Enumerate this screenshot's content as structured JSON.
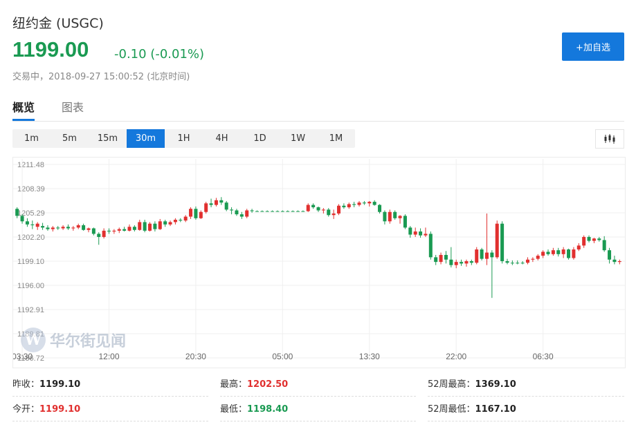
{
  "header": {
    "title": "纽约金 (USGC)",
    "price": "1199.00",
    "change": "-0.10 (-0.01%)",
    "status": "交易中，2018-09-27 15:00:52 (北京时间)",
    "add_watchlist": "+加自选"
  },
  "colors": {
    "up": "#e1302f",
    "down": "#1a9a52",
    "accent": "#1478dc",
    "flat": "#1a9a52"
  },
  "tabs": [
    {
      "label": "概览",
      "active": true
    },
    {
      "label": "图表",
      "active": false
    }
  ],
  "periods": [
    {
      "label": "1m",
      "active": false
    },
    {
      "label": "5m",
      "active": false
    },
    {
      "label": "15m",
      "active": false
    },
    {
      "label": "30m",
      "active": true
    },
    {
      "label": "1H",
      "active": false
    },
    {
      "label": "4H",
      "active": false
    },
    {
      "label": "1D",
      "active": false
    },
    {
      "label": "1W",
      "active": false
    },
    {
      "label": "1M",
      "active": false
    }
  ],
  "chart_type_icon": "candlestick-icon",
  "watermark": {
    "logo": "W",
    "text": "华尔街见闻"
  },
  "chart_data": {
    "type": "candlestick",
    "y_ticks": [
      "1211.48",
      "1208.39",
      "1205.29",
      "1202.20",
      "1199.10",
      "1196.00",
      "1192.91",
      "1189.81",
      "1186.72"
    ],
    "ylim": [
      1186.72,
      1211.48
    ],
    "x_ticks": [
      {
        "label": "03:30",
        "index": 1
      },
      {
        "label": "12:00",
        "index": 18
      },
      {
        "label": "20:30",
        "index": 35
      },
      {
        "label": "05:00",
        "index": 52
      },
      {
        "label": "13:30",
        "index": 69
      },
      {
        "label": "22:00",
        "index": 86
      },
      {
        "label": "06:30",
        "index": 103
      }
    ],
    "candles": [
      [
        1205.8,
        1206.0,
        1204.6,
        1204.9
      ],
      [
        1204.9,
        1205.1,
        1203.9,
        1204.2
      ],
      [
        1204.2,
        1204.6,
        1203.5,
        1203.8
      ],
      [
        1203.8,
        1204.3,
        1203.2,
        1203.7
      ],
      [
        1203.5,
        1204.1,
        1203.1,
        1203.9
      ],
      [
        1203.6,
        1204.0,
        1203.1,
        1203.4
      ],
      [
        1203.4,
        1203.7,
        1203.0,
        1203.2
      ],
      [
        1203.2,
        1203.6,
        1202.9,
        1203.4
      ],
      [
        1203.4,
        1203.6,
        1203.1,
        1203.3
      ],
      [
        1203.3,
        1203.7,
        1203.1,
        1203.5
      ],
      [
        1203.5,
        1203.8,
        1203.1,
        1203.3
      ],
      [
        1203.3,
        1203.6,
        1203.0,
        1203.4
      ],
      [
        1203.4,
        1203.9,
        1203.2,
        1203.7
      ],
      [
        1203.7,
        1203.9,
        1203.0,
        1203.1
      ],
      [
        1203.1,
        1203.4,
        1202.8,
        1203.3
      ],
      [
        1203.3,
        1203.4,
        1202.4,
        1202.6
      ],
      [
        1202.6,
        1202.8,
        1201.2,
        1202.2
      ],
      [
        1202.2,
        1203.3,
        1202.0,
        1203.0
      ],
      [
        1203.0,
        1203.3,
        1202.6,
        1202.9
      ],
      [
        1202.9,
        1203.2,
        1202.6,
        1203.0
      ],
      [
        1203.0,
        1203.4,
        1202.7,
        1203.2
      ],
      [
        1203.2,
        1203.5,
        1202.9,
        1203.0
      ],
      [
        1203.0,
        1203.8,
        1202.9,
        1203.5
      ],
      [
        1203.5,
        1203.7,
        1202.9,
        1203.1
      ],
      [
        1203.1,
        1204.4,
        1203.0,
        1204.1
      ],
      [
        1204.1,
        1204.4,
        1202.8,
        1203.0
      ],
      [
        1203.0,
        1204.1,
        1202.9,
        1203.9
      ],
      [
        1203.9,
        1204.2,
        1202.9,
        1203.2
      ],
      [
        1203.2,
        1204.5,
        1203.1,
        1204.2
      ],
      [
        1204.2,
        1204.4,
        1203.5,
        1203.8
      ],
      [
        1203.8,
        1204.3,
        1203.6,
        1204.1
      ],
      [
        1204.1,
        1204.6,
        1203.8,
        1204.4
      ],
      [
        1204.4,
        1204.6,
        1204.1,
        1204.3
      ],
      [
        1204.3,
        1205.0,
        1204.1,
        1204.8
      ],
      [
        1204.8,
        1206.0,
        1204.5,
        1205.8
      ],
      [
        1205.8,
        1206.1,
        1204.4,
        1204.6
      ],
      [
        1204.6,
        1205.6,
        1204.5,
        1205.4
      ],
      [
        1205.4,
        1206.7,
        1205.2,
        1206.5
      ],
      [
        1206.5,
        1207.1,
        1206.0,
        1206.3
      ],
      [
        1206.3,
        1207.2,
        1206.1,
        1206.9
      ],
      [
        1206.9,
        1207.3,
        1206.3,
        1206.6
      ],
      [
        1206.6,
        1206.8,
        1205.5,
        1205.7
      ],
      [
        1205.7,
        1206.0,
        1205.1,
        1205.6
      ],
      [
        1205.6,
        1205.8,
        1204.9,
        1205.1
      ],
      [
        1205.1,
        1205.4,
        1204.5,
        1204.8
      ],
      [
        1204.8,
        1205.8,
        1204.6,
        1205.6
      ],
      [
        1205.6,
        1205.8,
        1205.3,
        1205.5
      ],
      [
        1205.5,
        1205.6,
        1205.5,
        1205.5
      ],
      [
        1205.5,
        1205.6,
        1205.5,
        1205.5
      ],
      [
        1205.5,
        1205.6,
        1205.5,
        1205.5
      ],
      [
        1205.5,
        1205.6,
        1205.5,
        1205.5
      ],
      [
        1205.5,
        1205.6,
        1205.5,
        1205.5
      ],
      [
        1205.5,
        1205.6,
        1205.5,
        1205.5
      ],
      [
        1205.5,
        1205.6,
        1205.5,
        1205.5
      ],
      [
        1205.5,
        1205.6,
        1205.5,
        1205.5
      ],
      [
        1205.5,
        1205.6,
        1205.5,
        1205.5
      ],
      [
        1205.5,
        1205.6,
        1205.5,
        1205.5
      ],
      [
        1205.5,
        1206.5,
        1205.4,
        1206.3
      ],
      [
        1206.3,
        1206.5,
        1205.8,
        1206.0
      ],
      [
        1206.0,
        1206.1,
        1205.4,
        1205.6
      ],
      [
        1205.6,
        1205.9,
        1205.2,
        1205.7
      ],
      [
        1205.7,
        1205.9,
        1204.8,
        1205.0
      ],
      [
        1205.0,
        1205.7,
        1204.5,
        1205.2
      ],
      [
        1205.2,
        1206.4,
        1205.0,
        1206.2
      ],
      [
        1206.2,
        1206.5,
        1205.8,
        1206.0
      ],
      [
        1206.0,
        1206.6,
        1205.8,
        1206.4
      ],
      [
        1206.4,
        1206.7,
        1206.0,
        1206.3
      ],
      [
        1206.3,
        1206.8,
        1206.1,
        1206.6
      ],
      [
        1206.6,
        1206.8,
        1206.3,
        1206.5
      ],
      [
        1206.5,
        1206.8,
        1206.1,
        1206.7
      ],
      [
        1206.7,
        1206.9,
        1206.2,
        1206.3
      ],
      [
        1206.3,
        1206.4,
        1205.2,
        1205.4
      ],
      [
        1205.4,
        1205.6,
        1203.8,
        1204.2
      ],
      [
        1204.2,
        1205.7,
        1203.9,
        1205.4
      ],
      [
        1205.4,
        1205.6,
        1204.4,
        1204.6
      ],
      [
        1204.6,
        1205.0,
        1203.9,
        1204.9
      ],
      [
        1204.9,
        1205.1,
        1203.2,
        1203.4
      ],
      [
        1203.4,
        1203.6,
        1202.1,
        1202.5
      ],
      [
        1202.5,
        1203.4,
        1202.2,
        1202.9
      ],
      [
        1202.9,
        1203.3,
        1202.1,
        1202.4
      ],
      [
        1202.4,
        1203.4,
        1202.2,
        1202.6
      ],
      [
        1202.6,
        1202.9,
        1199.3,
        1199.6
      ],
      [
        1199.6,
        1199.9,
        1198.6,
        1199.0
      ],
      [
        1199.0,
        1200.2,
        1198.7,
        1199.9
      ],
      [
        1199.9,
        1200.4,
        1198.8,
        1199.3
      ],
      [
        1199.3,
        1200.9,
        1198.3,
        1198.6
      ],
      [
        1198.6,
        1199.3,
        1198.2,
        1199.0
      ],
      [
        1199.0,
        1199.3,
        1198.5,
        1198.8
      ],
      [
        1198.8,
        1199.3,
        1198.4,
        1199.1
      ],
      [
        1199.1,
        1199.3,
        1198.6,
        1198.9
      ],
      [
        1198.9,
        1200.9,
        1198.7,
        1200.6
      ],
      [
        1200.6,
        1200.8,
        1199.2,
        1199.4
      ],
      [
        1199.4,
        1205.2,
        1198.6,
        1200.2
      ],
      [
        1200.2,
        1200.5,
        1194.4,
        1199.6
      ],
      [
        1199.6,
        1204.3,
        1199.4,
        1203.9
      ],
      [
        1203.9,
        1204.2,
        1198.8,
        1199.1
      ],
      [
        1199.1,
        1199.4,
        1198.7,
        1198.9
      ],
      [
        1198.9,
        1199.2,
        1198.6,
        1198.9
      ],
      [
        1198.9,
        1199.2,
        1198.7,
        1198.9
      ],
      [
        1198.9,
        1199.1,
        1198.7,
        1198.9
      ],
      [
        1198.9,
        1199.6,
        1198.7,
        1199.3
      ],
      [
        1199.3,
        1199.6,
        1199.0,
        1199.4
      ],
      [
        1199.4,
        1200.0,
        1199.2,
        1199.8
      ],
      [
        1199.8,
        1200.5,
        1199.5,
        1200.3
      ],
      [
        1200.3,
        1200.6,
        1199.8,
        1200.0
      ],
      [
        1200.0,
        1200.8,
        1199.8,
        1200.5
      ],
      [
        1200.5,
        1200.8,
        1199.7,
        1200.0
      ],
      [
        1200.0,
        1200.9,
        1199.5,
        1200.6
      ],
      [
        1200.6,
        1200.7,
        1199.3,
        1199.5
      ],
      [
        1199.5,
        1200.9,
        1199.3,
        1200.6
      ],
      [
        1200.6,
        1201.4,
        1200.4,
        1201.1
      ],
      [
        1201.1,
        1202.4,
        1200.8,
        1202.2
      ],
      [
        1202.2,
        1202.4,
        1201.5,
        1201.7
      ],
      [
        1201.7,
        1202.1,
        1201.4,
        1202.0
      ],
      [
        1202.0,
        1202.2,
        1201.6,
        1201.8
      ],
      [
        1201.8,
        1202.3,
        1200.3,
        1200.5
      ],
      [
        1200.5,
        1200.8,
        1198.8,
        1199.3
      ],
      [
        1199.3,
        1199.8,
        1198.7,
        1199.0
      ],
      [
        1199.0,
        1199.3,
        1198.7,
        1199.1
      ]
    ]
  },
  "stats": {
    "col1": [
      {
        "label": "昨收：",
        "value": "1199.10",
        "tone": "dark"
      },
      {
        "label": "今开：",
        "value": "1199.10",
        "tone": "red"
      }
    ],
    "col2": [
      {
        "label": "最高：",
        "value": "1202.50",
        "tone": "red"
      },
      {
        "label": "最低：",
        "value": "1198.40",
        "tone": "green"
      }
    ],
    "col3": [
      {
        "label": "52周最高：",
        "value": "1369.10",
        "tone": "dark"
      },
      {
        "label": "52周最低：",
        "value": "1167.10",
        "tone": "dark"
      }
    ]
  }
}
